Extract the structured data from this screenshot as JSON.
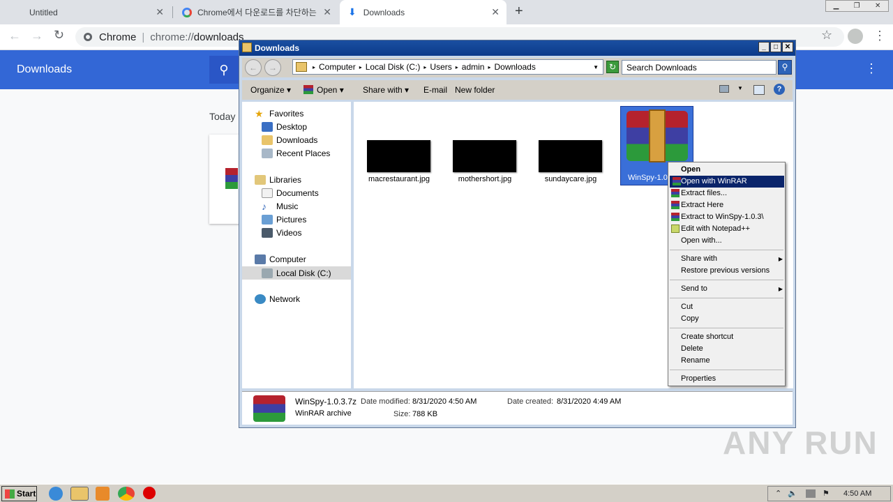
{
  "browser": {
    "tabs": [
      {
        "label": "Untitled"
      },
      {
        "label": "Chrome에서 다운로드를 차단하는 경"
      },
      {
        "label": "Downloads"
      }
    ],
    "new_tab_symbol": "+",
    "omnibox_site": "Chrome",
    "omnibox_url_scheme": "chrome://",
    "omnibox_url_path": "downloads"
  },
  "downloads_page": {
    "title": "Downloads",
    "section_today": "Today"
  },
  "explorer": {
    "title": "Downloads",
    "breadcrumb": [
      "Computer",
      "Local Disk (C:)",
      "Users",
      "admin",
      "Downloads"
    ],
    "search_placeholder": "Search Downloads",
    "commands": {
      "organize": "Organize",
      "open": "Open",
      "share_with": "Share with",
      "email": "E-mail",
      "new_folder": "New folder"
    },
    "nav": {
      "favorites": "Favorites",
      "desktop": "Desktop",
      "downloads": "Downloads",
      "recent_places": "Recent Places",
      "libraries": "Libraries",
      "documents": "Documents",
      "music": "Music",
      "pictures": "Pictures",
      "videos": "Videos",
      "computer": "Computer",
      "local_disk": "Local Disk (C:)",
      "network": "Network"
    },
    "files": [
      {
        "name": "macrestaurant.jpg"
      },
      {
        "name": "mothershort.jpg"
      },
      {
        "name": "sundaycare.jpg"
      },
      {
        "name": "WinSpy-1.0"
      }
    ],
    "details": {
      "filename": "WinSpy-1.0.3.7z",
      "type": "WinRAR archive",
      "date_modified_label": "Date modified:",
      "date_modified": "8/31/2020 4:50 AM",
      "date_created_label": "Date created:",
      "date_created": "8/31/2020 4:49 AM",
      "size_label": "Size:",
      "size": "788 KB"
    }
  },
  "context_menu": {
    "open": "Open",
    "open_winrar": "Open with WinRAR",
    "extract_files": "Extract files...",
    "extract_here": "Extract Here",
    "extract_to": "Extract to WinSpy-1.0.3\\",
    "edit_notepad": "Edit with Notepad++",
    "open_with": "Open with...",
    "share_with": "Share with",
    "restore": "Restore previous versions",
    "send_to": "Send to",
    "cut": "Cut",
    "copy": "Copy",
    "create_shortcut": "Create shortcut",
    "delete": "Delete",
    "rename": "Rename",
    "properties": "Properties"
  },
  "taskbar": {
    "start": "Start",
    "clock": "4:50 AM"
  },
  "watermark": "ANY RUN",
  "colors": {
    "chrome_blue": "#3367d6",
    "menu_highlight": "#0a246a",
    "title_blue": "#0b3a8a"
  }
}
